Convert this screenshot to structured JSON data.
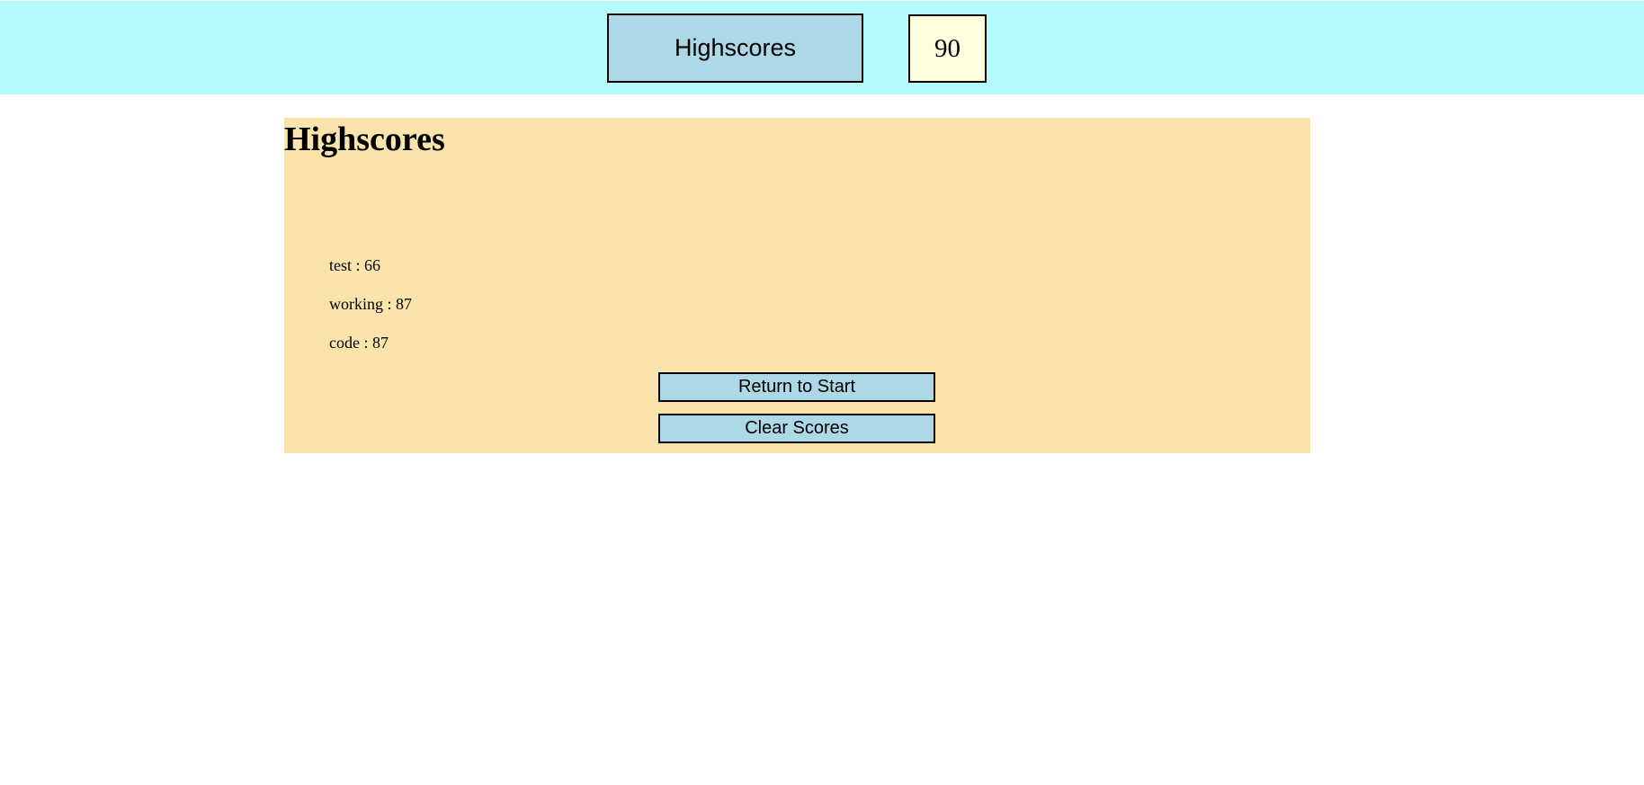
{
  "header": {
    "highscores_button": "Highscores",
    "timer": "90"
  },
  "panel": {
    "title": "Highscores",
    "scores": [
      "test : 66",
      "working : 87",
      "code : 87"
    ],
    "return_button": "Return to Start",
    "clear_button": "Clear Scores"
  },
  "colors": {
    "header_bg": "#b3fcfb",
    "panel_bg": "#fbe4ac",
    "button_bg": "#add8e6",
    "timer_bg": "#ffffe0"
  }
}
